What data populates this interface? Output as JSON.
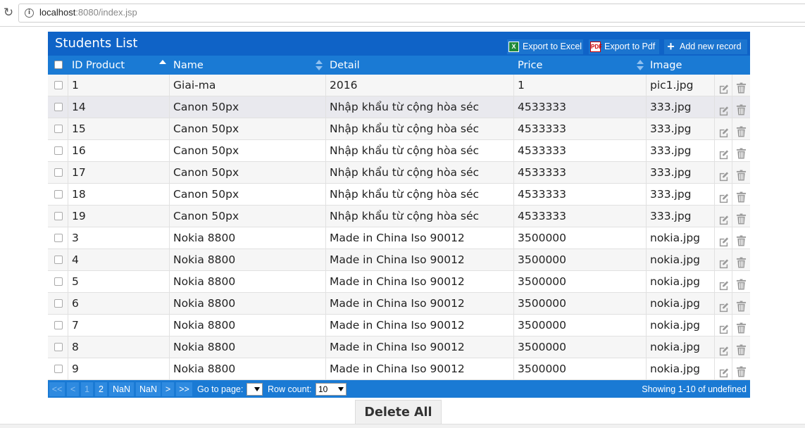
{
  "browser": {
    "url_host": "localhost",
    "url_rest": ":8080/index.jsp"
  },
  "grid": {
    "title": "Students List",
    "toolbar": {
      "export_excel": "Export to Excel",
      "export_pdf": "Export to Pdf",
      "add_new": "Add new record"
    },
    "columns": [
      "ID Product",
      "Name",
      "Detail",
      "Price",
      "Image"
    ],
    "rows": [
      {
        "id": "1",
        "name": "Giai-ma",
        "detail": "2016",
        "price": "1",
        "image": "pic1.jpg"
      },
      {
        "id": "14",
        "name": "Canon 50px",
        "detail": "Nhập khẩu từ cộng hòa séc",
        "price": "4533333",
        "image": "333.jpg"
      },
      {
        "id": "15",
        "name": "Canon 50px",
        "detail": "Nhập khẩu từ cộng hòa séc",
        "price": "4533333",
        "image": "333.jpg"
      },
      {
        "id": "16",
        "name": "Canon 50px",
        "detail": "Nhập khẩu từ cộng hòa séc",
        "price": "4533333",
        "image": "333.jpg"
      },
      {
        "id": "17",
        "name": "Canon 50px",
        "detail": "Nhập khẩu từ cộng hòa séc",
        "price": "4533333",
        "image": "333.jpg"
      },
      {
        "id": "18",
        "name": "Canon 50px",
        "detail": "Nhập khẩu từ cộng hòa séc",
        "price": "4533333",
        "image": "333.jpg"
      },
      {
        "id": "19",
        "name": "Canon 50px",
        "detail": "Nhập khẩu từ cộng hòa séc",
        "price": "4533333",
        "image": "333.jpg"
      },
      {
        "id": "3",
        "name": "Nokia 8800",
        "detail": "Made in China Iso 90012",
        "price": "3500000",
        "image": "nokia.jpg"
      },
      {
        "id": "4",
        "name": "Nokia 8800",
        "detail": "Made in China Iso 90012",
        "price": "3500000",
        "image": "nokia.jpg"
      },
      {
        "id": "5",
        "name": "Nokia 8800",
        "detail": "Made in China Iso 90012",
        "price": "3500000",
        "image": "nokia.jpg"
      },
      {
        "id": "6",
        "name": "Nokia 8800",
        "detail": "Made in China Iso 90012",
        "price": "3500000",
        "image": "nokia.jpg"
      },
      {
        "id": "7",
        "name": "Nokia 8800",
        "detail": "Made in China Iso 90012",
        "price": "3500000",
        "image": "nokia.jpg"
      },
      {
        "id": "8",
        "name": "Nokia 8800",
        "detail": "Made in China Iso 90012",
        "price": "3500000",
        "image": "nokia.jpg"
      },
      {
        "id": "9",
        "name": "Nokia 8800",
        "detail": "Made in China Iso 90012",
        "price": "3500000",
        "image": "nokia.jpg"
      }
    ],
    "selected_row": 1,
    "pager": {
      "first": "<<",
      "prev": "<",
      "pages": [
        "1",
        "2",
        "NaN",
        "NaN"
      ],
      "next": ">",
      "last": ">>",
      "goto_label": "Go to page:",
      "goto_value": "",
      "rowcount_label": "Row count:",
      "rowcount_value": "10",
      "showing": "Showing 1-10 of undefined"
    }
  },
  "delete_all": "Delete All",
  "icons": {
    "reload": "reload-icon",
    "info": "info-icon",
    "excel": "excel-icon",
    "pdf": "pdf-icon",
    "add": "plus-icon",
    "edit": "edit-icon",
    "delete": "trash-icon"
  },
  "colors": {
    "grid_header": "#0f63c7",
    "grid_primary": "#1a7ad4"
  }
}
